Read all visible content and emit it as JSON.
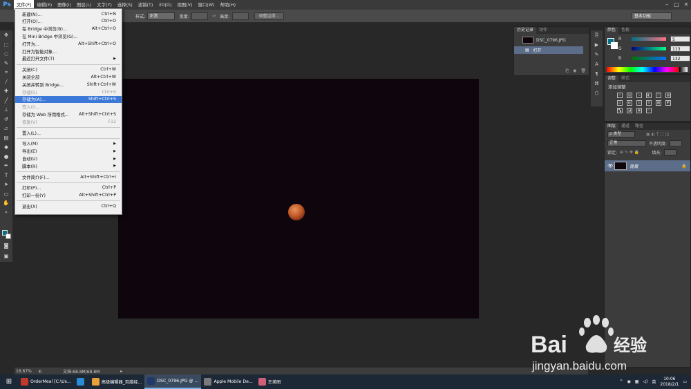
{
  "app": {
    "logo": "Ps"
  },
  "menubar": {
    "items": [
      "文件(F)",
      "编辑(E)",
      "图像(I)",
      "图层(L)",
      "文字(Y)",
      "选择(S)",
      "滤镜(T)",
      "3D(D)",
      "视图(V)",
      "窗口(W)",
      "帮助(H)"
    ],
    "window_controls": [
      "–",
      "□",
      "✕"
    ]
  },
  "options_bar": {
    "style_label": "样式:",
    "style_value": "正常",
    "width_label": "宽度:",
    "height_label": "高度:",
    "refine_button": "调整边缘...",
    "workspace": "基本功能"
  },
  "file_menu": {
    "items": [
      {
        "label": "新建(N)...",
        "shortcut": "Ctrl+N",
        "disabled": false,
        "arrow": false
      },
      {
        "label": "打开(O)...",
        "shortcut": "Ctrl+O",
        "disabled": false,
        "arrow": false
      },
      {
        "label": "在 Bridge 中浏览(B)...",
        "shortcut": "Alt+Ctrl+O",
        "disabled": false,
        "arrow": false
      },
      {
        "label": "在 Mini Bridge 中浏览(G)...",
        "shortcut": "",
        "disabled": false,
        "arrow": false
      },
      {
        "label": "打开为...",
        "shortcut": "Alt+Shift+Ctrl+O",
        "disabled": false,
        "arrow": false
      },
      {
        "label": "打开为智能对象...",
        "shortcut": "",
        "disabled": false,
        "arrow": false
      },
      {
        "label": "最近打开文件(T)",
        "shortcut": "",
        "disabled": false,
        "arrow": true
      },
      {
        "label": "关闭(C)",
        "shortcut": "Ctrl+W",
        "disabled": false,
        "arrow": false
      },
      {
        "label": "关闭全部",
        "shortcut": "Alt+Ctrl+W",
        "disabled": false,
        "arrow": false
      },
      {
        "label": "关闭并转到 Bridge...",
        "shortcut": "Shift+Ctrl+W",
        "disabled": false,
        "arrow": false
      },
      {
        "label": "存储(S)",
        "shortcut": "Ctrl+S",
        "disabled": true,
        "arrow": false
      },
      {
        "label": "存储为(A)...",
        "shortcut": "Shift+Ctrl+S",
        "disabled": false,
        "arrow": false,
        "highlighted": true
      },
      {
        "label": "签入(I)...",
        "shortcut": "",
        "disabled": true,
        "arrow": false
      },
      {
        "label": "存储为 Web 所用格式...",
        "shortcut": "Alt+Shift+Ctrl+S",
        "disabled": false,
        "arrow": false
      },
      {
        "label": "恢复(V)",
        "shortcut": "F12",
        "disabled": true,
        "arrow": false
      },
      {
        "label": "置入(L)...",
        "shortcut": "",
        "disabled": false,
        "arrow": false
      },
      {
        "label": "导入(M)",
        "shortcut": "",
        "disabled": false,
        "arrow": true
      },
      {
        "label": "导出(E)",
        "shortcut": "",
        "disabled": false,
        "arrow": true
      },
      {
        "label": "自动(U)",
        "shortcut": "",
        "disabled": false,
        "arrow": true
      },
      {
        "label": "脚本(R)",
        "shortcut": "",
        "disabled": false,
        "arrow": true
      },
      {
        "label": "文件简介(F)...",
        "shortcut": "Alt+Shift+Ctrl+I",
        "disabled": false,
        "arrow": false
      },
      {
        "label": "打印(P)...",
        "shortcut": "Ctrl+P",
        "disabled": false,
        "arrow": false
      },
      {
        "label": "打印一份(Y)",
        "shortcut": "Alt+Shift+Ctrl+P",
        "disabled": false,
        "arrow": false
      },
      {
        "label": "退出(X)",
        "shortcut": "Ctrl+Q",
        "disabled": false,
        "arrow": false
      }
    ]
  },
  "history_panel": {
    "tabs": [
      "历史记录",
      "动作"
    ],
    "snapshot": "DSC_0796.JPG",
    "state": "打开"
  },
  "color_panel": {
    "tabs": [
      "颜色",
      "色板"
    ],
    "channels": [
      {
        "label": "R",
        "value": "5",
        "grad_from": "#007184",
        "grad_to": "#ff7184"
      },
      {
        "label": "G",
        "value": "113",
        "grad_from": "#050084",
        "grad_to": "#05ff84"
      },
      {
        "label": "B",
        "value": "132",
        "grad_from": "#057100",
        "grad_to": "#0571ff"
      }
    ],
    "foreground": "#057184",
    "background": "#ffffff"
  },
  "adjustments_panel": {
    "tabs": [
      "调整",
      "样式"
    ],
    "title": "添加调整"
  },
  "layers_panel": {
    "tabs": [
      "图层",
      "通道",
      "路径"
    ],
    "kind_filter": "ρ 类型",
    "blend_mode": "正常",
    "opacity_label": "不透明度:",
    "lock_label": "锁定:",
    "fill_label": "填充:",
    "layer_name": "背景"
  },
  "statusbar": {
    "zoom": "16.67%",
    "doc_info": "文档:68.8M/68.8M"
  },
  "taskbar": {
    "apps": [
      {
        "label": "OrderMeal [C:\\Us...",
        "color": "#c0392b",
        "active": false
      },
      {
        "label": "",
        "color": "#2a8bd6",
        "active": false
      },
      {
        "label": "高级编辑器_百度经...",
        "color": "#e8a03a",
        "active": false
      },
      {
        "label": "DSC_0796.JPG @ ...",
        "color": "#1f3a6a",
        "active": true
      },
      {
        "label": "Apple Mobile De...",
        "color": "#7a7a7a",
        "active": false
      },
      {
        "label": "王美图",
        "color": "#d0607a",
        "active": false
      }
    ],
    "ime": "英",
    "time": "10:06",
    "date": "2018/2/1"
  },
  "watermark": {
    "brand": "Bai",
    "brand2": "经验",
    "url": "jingyan.baidu.com"
  }
}
